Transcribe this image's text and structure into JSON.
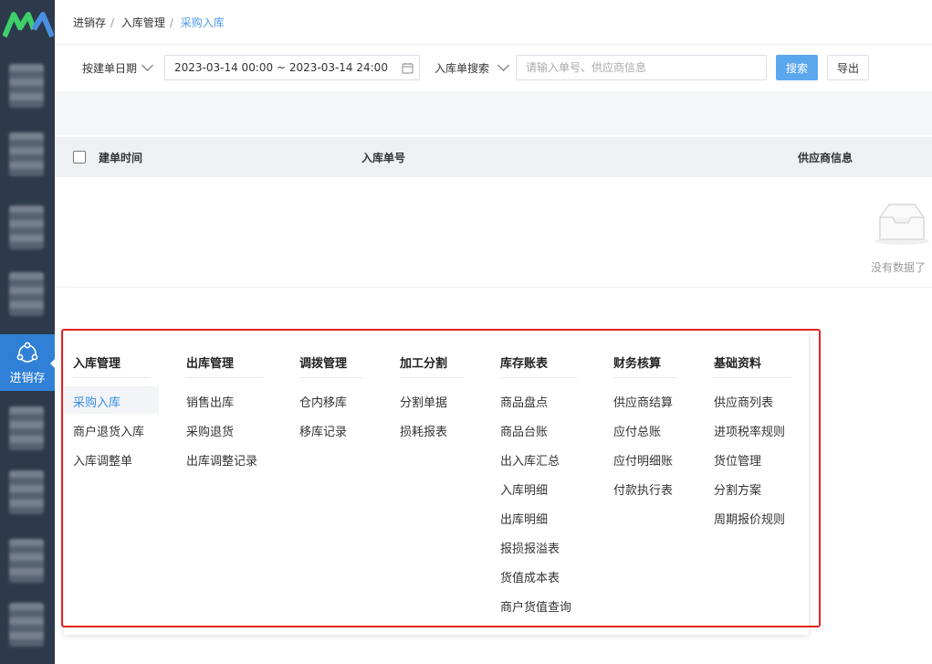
{
  "sidebar": {
    "active_label": "进销存",
    "brand_colors": {
      "sidebar_bg": "#2d3a4b",
      "active": "#2f80d6",
      "logo_green": "#3ecf6b",
      "logo_blue": "#4a90e2"
    }
  },
  "breadcrumb": {
    "item1": "进销存",
    "item2": "入库管理",
    "item3": "采购入库",
    "sep": "/"
  },
  "filters": {
    "date_type_label": "按建单日期",
    "date_range": "2023-03-14 00:00 ~ 2023-03-14 24:00",
    "search_type_label": "入库单搜索",
    "search_placeholder": "请输入单号、供应商信息",
    "search_button": "搜索",
    "export_button": "导出"
  },
  "table": {
    "columns": [
      "建单时间",
      "入库单号",
      "供应商信息"
    ],
    "empty_text": "没有数据了"
  },
  "menu": {
    "columns": [
      {
        "title": "入库管理",
        "items": [
          "采购入库",
          "商户退货入库",
          "入库调整单"
        ],
        "active": 0
      },
      {
        "title": "出库管理",
        "items": [
          "销售出库",
          "采购退货",
          "出库调整记录"
        ]
      },
      {
        "title": "调拨管理",
        "items": [
          "仓内移库",
          "移库记录"
        ]
      },
      {
        "title": "加工分割",
        "items": [
          "分割单据",
          "损耗报表"
        ]
      },
      {
        "title": "库存账表",
        "items": [
          "商品盘点",
          "商品台账",
          "出入库汇总",
          "入库明细",
          "出库明细",
          "报损报溢表",
          "货值成本表",
          "商户货值查询"
        ]
      },
      {
        "title": "财务核算",
        "items": [
          "供应商结算",
          "应付总账",
          "应付明细账",
          "付款执行表"
        ]
      },
      {
        "title": "基础资料",
        "items": [
          "供应商列表",
          "进项税率规则",
          "货位管理",
          "分割方案",
          "周期报价规则"
        ]
      }
    ]
  }
}
